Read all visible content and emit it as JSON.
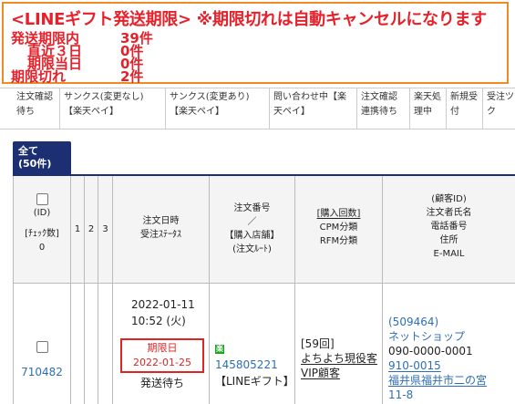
{
  "alert": {
    "title": "<LINEギフト発送期限> ※期限切れは自動キャンセルになります",
    "rows": [
      {
        "label": "発送期限内",
        "value": "39件"
      },
      {
        "label": "直近３日",
        "value": "0件"
      },
      {
        "label": "期限当日",
        "value": "0件"
      },
      {
        "label": "期限切れ",
        "value": "2件"
      }
    ]
  },
  "status_tabs": [
    {
      "label": "注文確認待ち"
    },
    {
      "label": "サンクス(変更なし)【楽天ペイ】"
    },
    {
      "label": "サンクス(変更あり)【楽天ペイ】"
    },
    {
      "label": "問い合わせ中【楽天ペイ】"
    },
    {
      "label": "注文確認連携待ち"
    },
    {
      "label": "楽天処理中"
    },
    {
      "label": "新規受付"
    },
    {
      "label": "受注ツク"
    }
  ],
  "tab_all": {
    "line1": "全て",
    "line2": "(50件)"
  },
  "table": {
    "headers": {
      "id_top": "(ID)",
      "check_count": "[ﾁｪｯｸ数]",
      "check_value": "0",
      "c1": "1",
      "c2": "2",
      "c3": "3",
      "date": "注文日時",
      "status": "受注ｽﾃｰﾀｽ",
      "order_no": "注文番号",
      "slash": "／",
      "store": "【購入店舗】",
      "route": "(注文ﾙｰﾄ)",
      "purchase_count": "[購入回数]",
      "cpm": "CPM分類",
      "rfm": "RFM分類",
      "customer_id": "(顧客ID)",
      "orderer_name": "注文者氏名",
      "phone": "電話番号",
      "address": "住所",
      "email": "E-MAIL"
    },
    "row": {
      "id": "710482",
      "date": "2022-01-11",
      "time": "10:52 (火)",
      "deadline_label": "期限日",
      "deadline_date": "2022-01-25",
      "status": "発送待ち",
      "order_icon": "楽",
      "order_no": "145805221",
      "store": "【LINEギフト】",
      "purchase_count": "[59回]",
      "cpm": "よちよち現役客",
      "rfm": "VIP顧客",
      "customer_id": "(509464)",
      "customer_name": "ネットショップ",
      "phone": "090-0000-0001",
      "zip": "910-0015",
      "address1": "福井県福井市二の宮",
      "address2": "11-8"
    }
  }
}
